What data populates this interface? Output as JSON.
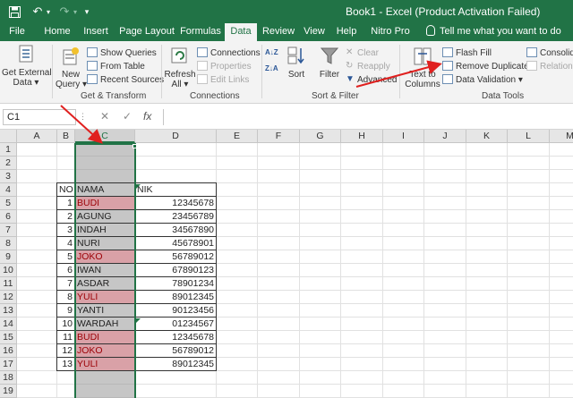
{
  "titlebar": {
    "title": "Book1 - Excel (Product Activation Failed)",
    "bg_color": "#217346"
  },
  "tabs": [
    {
      "label": "File",
      "name": "tab-file"
    },
    {
      "label": "Home",
      "name": "tab-home"
    },
    {
      "label": "Insert",
      "name": "tab-insert"
    },
    {
      "label": "Page Layout",
      "name": "tab-page-layout"
    },
    {
      "label": "Formulas",
      "name": "tab-formulas"
    },
    {
      "label": "Data",
      "name": "tab-data",
      "active": true
    },
    {
      "label": "Review",
      "name": "tab-review"
    },
    {
      "label": "View",
      "name": "tab-view"
    },
    {
      "label": "Help",
      "name": "tab-help"
    },
    {
      "label": "Nitro Pro",
      "name": "tab-nitro-pro"
    }
  ],
  "tellme": "Tell me what you want to do",
  "ribbon": {
    "get_external_data": [
      "Get External",
      "Data"
    ],
    "new_query": [
      "New",
      "Query"
    ],
    "show_queries": "Show Queries",
    "from_table": "From Table",
    "recent_sources": "Recent Sources",
    "group_get_transform": "Get & Transform",
    "refresh_all": [
      "Refresh",
      "All"
    ],
    "connections": "Connections",
    "properties": "Properties",
    "edit_links": "Edit Links",
    "group_connections": "Connections",
    "sort": "Sort",
    "filter": "Filter",
    "clear": "Clear",
    "reapply": "Reapply",
    "advanced": "Advanced",
    "group_sort_filter": "Sort & Filter",
    "text_to_columns": [
      "Text to",
      "Columns"
    ],
    "flash_fill": "Flash Fill",
    "remove_duplicates": "Remove Duplicates",
    "data_validation": "Data Validation",
    "consolidate": "Consolidate",
    "relationships": "Relationships",
    "group_data_tools": "Data Tools"
  },
  "formula_bar": {
    "name_box": "C1",
    "cancel": "✕",
    "enter": "✓",
    "fx": "fx",
    "content": ""
  },
  "columns": [
    "A",
    "B",
    "C",
    "D",
    "E",
    "F",
    "G",
    "H",
    "I",
    "J",
    "K",
    "L",
    "M"
  ],
  "selected_column": "C",
  "rows": [
    "1",
    "2",
    "3",
    "4",
    "5",
    "6",
    "7",
    "8",
    "9",
    "10",
    "11",
    "12",
    "13",
    "14",
    "15",
    "16",
    "17",
    "18",
    "19"
  ],
  "table": {
    "header": {
      "no": "NO",
      "nama": "NAMA",
      "nik": "NIK"
    },
    "rows": [
      {
        "no": "1",
        "nama": "BUDI",
        "nik": "12345678",
        "dup": true
      },
      {
        "no": "2",
        "nama": "AGUNG",
        "nik": "23456789",
        "dup": false
      },
      {
        "no": "3",
        "nama": "INDAH",
        "nik": "34567890",
        "dup": false
      },
      {
        "no": "4",
        "nama": "NURI",
        "nik": "45678901",
        "dup": false
      },
      {
        "no": "5",
        "nama": "JOKO",
        "nik": "56789012",
        "dup": true
      },
      {
        "no": "6",
        "nama": "IWAN",
        "nik": "67890123",
        "dup": false
      },
      {
        "no": "7",
        "nama": "ASDAR",
        "nik": "78901234",
        "dup": false
      },
      {
        "no": "8",
        "nama": "YULI",
        "nik": "89012345",
        "dup": true
      },
      {
        "no": "9",
        "nama": "YANTI",
        "nik": "90123456",
        "dup": false
      },
      {
        "no": "10",
        "nama": "WARDAH",
        "nik": "01234567",
        "dup": false
      },
      {
        "no": "11",
        "nama": "BUDI",
        "nik": "12345678",
        "dup": true
      },
      {
        "no": "12",
        "nama": "JOKO",
        "nik": "56789012",
        "dup": true
      },
      {
        "no": "13",
        "nama": "YULI",
        "nik": "89012345",
        "dup": true
      }
    ]
  },
  "colors": {
    "excel_green": "#217346",
    "duplicate_fill": "#d9a1a7",
    "duplicate_text": "#9c0006",
    "selection_fill": "#c6c6c6",
    "annotation_arrow": "#e0201f"
  }
}
